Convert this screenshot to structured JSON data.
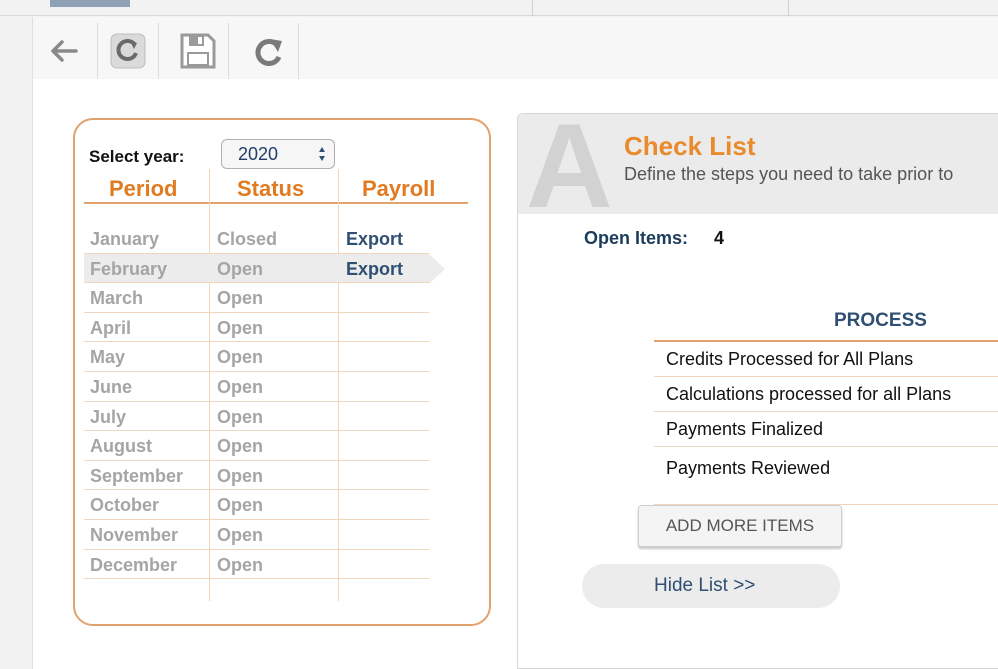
{
  "toolbar": {
    "icons": [
      "back-arrow-icon",
      "refresh-icon",
      "save-icon",
      "redo-icon"
    ]
  },
  "period_panel": {
    "year_label": "Select year:",
    "year_value": "2020",
    "headers": {
      "period": "Period",
      "status": "Status",
      "payroll": "Payroll"
    },
    "rows": [
      {
        "month": "January",
        "status": "Closed",
        "payroll": "Export"
      },
      {
        "month": "February",
        "status": "Open",
        "payroll": "Export",
        "selected": true
      },
      {
        "month": "March",
        "status": "Open",
        "payroll": ""
      },
      {
        "month": "April",
        "status": "Open",
        "payroll": ""
      },
      {
        "month": "May",
        "status": "Open",
        "payroll": ""
      },
      {
        "month": "June",
        "status": "Open",
        "payroll": ""
      },
      {
        "month": "July",
        "status": "Open",
        "payroll": ""
      },
      {
        "month": "August",
        "status": "Open",
        "payroll": ""
      },
      {
        "month": "September",
        "status": "Open",
        "payroll": ""
      },
      {
        "month": "October",
        "status": "Open",
        "payroll": ""
      },
      {
        "month": "November",
        "status": "Open",
        "payroll": ""
      },
      {
        "month": "December",
        "status": "Open",
        "payroll": ""
      }
    ]
  },
  "checklist": {
    "badge_letter": "A",
    "title": "Check List",
    "subtitle": "Define the steps you need to take prior to",
    "open_items_label": "Open Items:",
    "open_items_count": "4",
    "process_header": "PROCESS",
    "items": [
      "Credits Processed for All Plans",
      "Calculations processed for all Plans",
      "Payments Finalized",
      "Payments Reviewed"
    ],
    "add_button": "ADD MORE ITEMS",
    "hide_button": "Hide List >>"
  },
  "colors": {
    "accent_orange": "#e07b22",
    "border_orange": "#e0a36c",
    "navy": "#2f4f73",
    "muted_text": "#a5a5a5"
  }
}
